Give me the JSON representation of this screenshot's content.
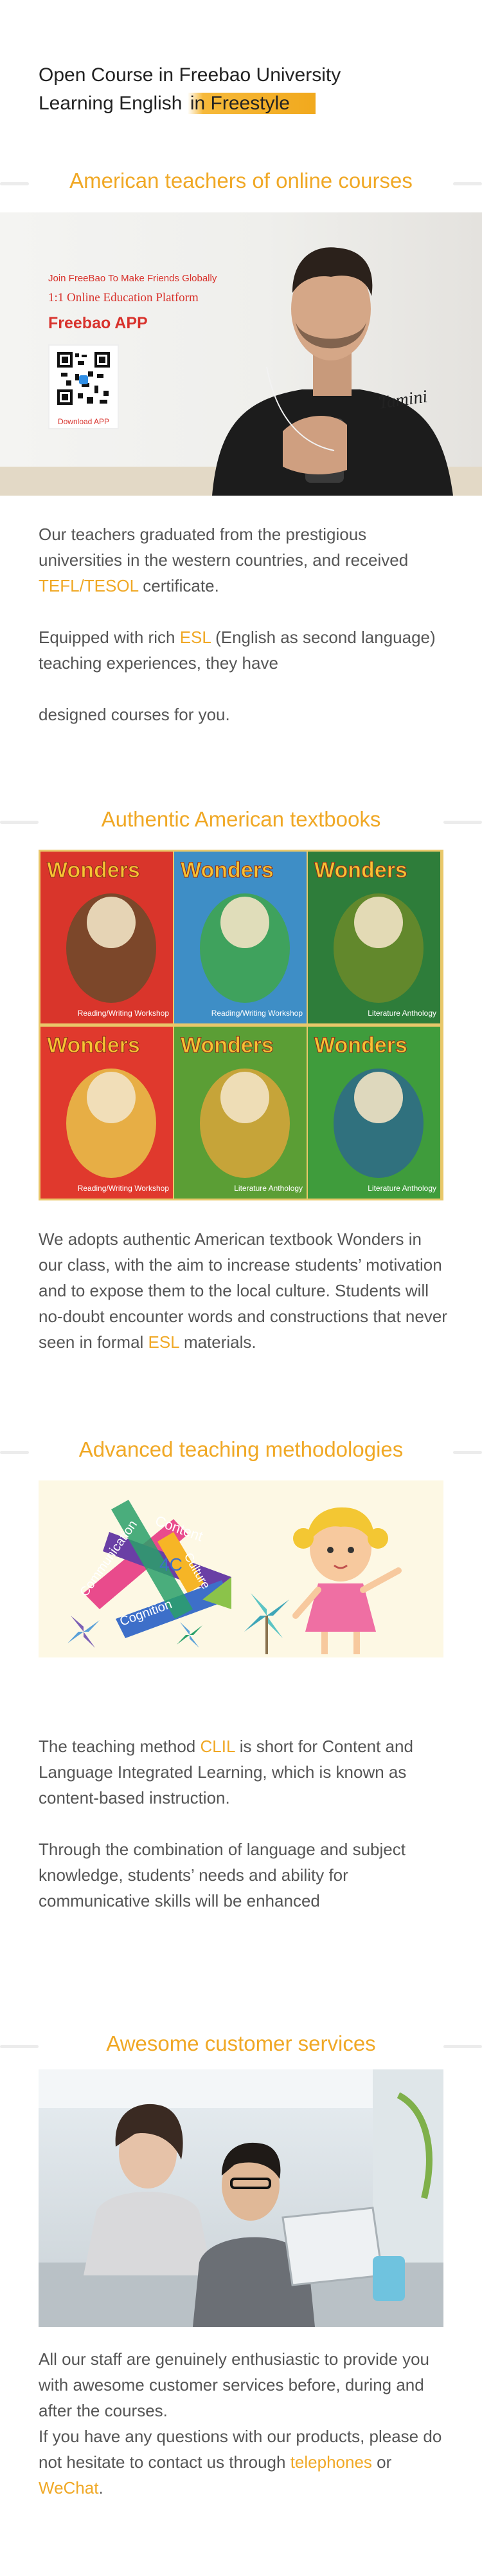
{
  "hero": {
    "line1": "Open Course in Freebao University",
    "line2_prefix": "Learning English ",
    "line2_highlight": "in Freestyle"
  },
  "section1": {
    "title": "American teachers of online courses",
    "banner": {
      "tagline": "Join FreeBao To Make Friends Globally",
      "platform": "1:1 Online Education Platform",
      "app_name": "Freebao APP",
      "download_label": "Download APP",
      "signature": "Tamini"
    },
    "para1_a": "Our teachers graduated from the prestigious universities in the western countries, and received ",
    "para1_hl": "TEFL/TESOL",
    "para1_b": " certificate.",
    "para2_a": "Equipped with rich ",
    "para2_hl": "ESL",
    "para2_b": " (English as second language) teaching experiences, they have",
    "para3": "designed courses for you."
  },
  "section2": {
    "title": "Authentic American textbooks",
    "books": [
      {
        "brand": "Wonders",
        "caption": "Reading/Writing Workshop",
        "bg": "#d9352b"
      },
      {
        "brand": "Wonders",
        "caption": "Reading/Writing Workshop",
        "bg": "#3e8ec6"
      },
      {
        "brand": "Wonders",
        "caption": "Literature Anthology",
        "bg": "#2e7d3a"
      },
      {
        "brand": "Wonders",
        "caption": "Reading/Writing Workshop",
        "bg": "#e0392d"
      },
      {
        "brand": "Wonders",
        "caption": "Literature Anthology",
        "bg": "#5b9e35"
      },
      {
        "brand": "Wonders",
        "caption": "Literature Anthology",
        "bg": "#3f9c3c"
      }
    ],
    "para_a": "We adopts authentic American textbook Wonders in our class, with the aim to increase students’ motivation and to expose them to the local culture. Students will no-doubt encounter words and constructions that never seen in formal ",
    "para_hl": "ESL",
    "para_b": " materials."
  },
  "section3": {
    "title": "Advanced teaching methodologies",
    "diagram": {
      "center": "4C",
      "words": [
        "Content",
        "Communication",
        "Culture",
        "Cognition"
      ]
    },
    "para1_a": "The teaching method ",
    "para1_hl": "CLIL",
    "para1_b": " is short for Content and Language Integrated Learning, which is known as content-based instruction.",
    "para2": "Through the combination of language and subject knowledge, students’ needs and ability for communicative skills will be enhanced"
  },
  "section4": {
    "title": "Awesome customer services",
    "para_a": "All our staff are genuinely enthusiastic to provide you with awesome customer services before, during and after the courses.",
    "para_b": "If you have any questions with our products, please do not hesitate to contact us through ",
    "hl1": "telephones",
    "mid": " or ",
    "hl2": "WeChat",
    "end": "."
  },
  "colors": {
    "accent": "#f0a825",
    "text": "#555555",
    "title": "#222222"
  }
}
